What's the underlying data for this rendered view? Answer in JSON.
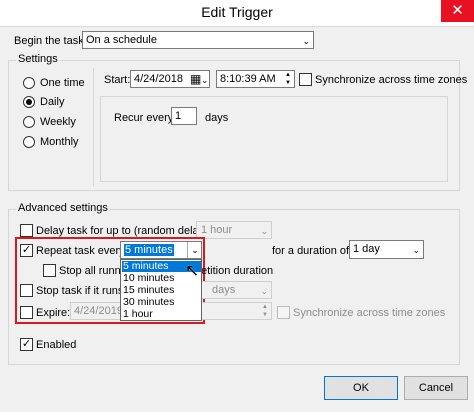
{
  "window": {
    "title": "Edit Trigger",
    "close_glyph": "✕"
  },
  "begin": {
    "label": "Begin the task:",
    "value": "On a schedule"
  },
  "settings": {
    "group_label": "Settings",
    "radios": [
      {
        "label": "One time",
        "checked": false
      },
      {
        "label": "Daily",
        "checked": true
      },
      {
        "label": "Weekly",
        "checked": false
      },
      {
        "label": "Monthly",
        "checked": false
      }
    ],
    "start_label": "Start:",
    "start_date": "4/24/2018",
    "start_time": "8:10:39 AM",
    "sync_label": "Synchronize across time zones",
    "recur_label": "Recur every:",
    "recur_value": "1",
    "recur_unit": "days"
  },
  "advanced": {
    "group_label": "Advanced settings",
    "delay_label": "Delay task for up to (random delay):",
    "delay_value": "1 hour",
    "repeat_label": "Repeat task every:",
    "repeat_value": "5 minutes",
    "duration_label": "for a duration of:",
    "duration_value": "1 day",
    "stop_all_label": "Stop all runnin",
    "stop_all_suffix": "etition duration",
    "stop_task_label": "Stop task if it runs lo",
    "stop_task_value": "days",
    "expire_label": "Expire:",
    "expire_date": "4/24/2019",
    "expire_time": "1",
    "expire_sync_label": "Synchronize across time zones",
    "enabled_label": "Enabled",
    "dropdown_options": [
      "5 minutes",
      "10 minutes",
      "15 minutes",
      "30 minutes",
      "1 hour"
    ],
    "dropdown_selected": "5 minutes"
  },
  "buttons": {
    "ok": "OK",
    "cancel": "Cancel"
  },
  "glyphs": {
    "check": "✓",
    "chevron": "⌄",
    "calendar": "▦",
    "cursor": "↖"
  },
  "colors": {
    "highlight_box": "#d9191b",
    "selection": "#0078d7",
    "close": "#e81123"
  }
}
